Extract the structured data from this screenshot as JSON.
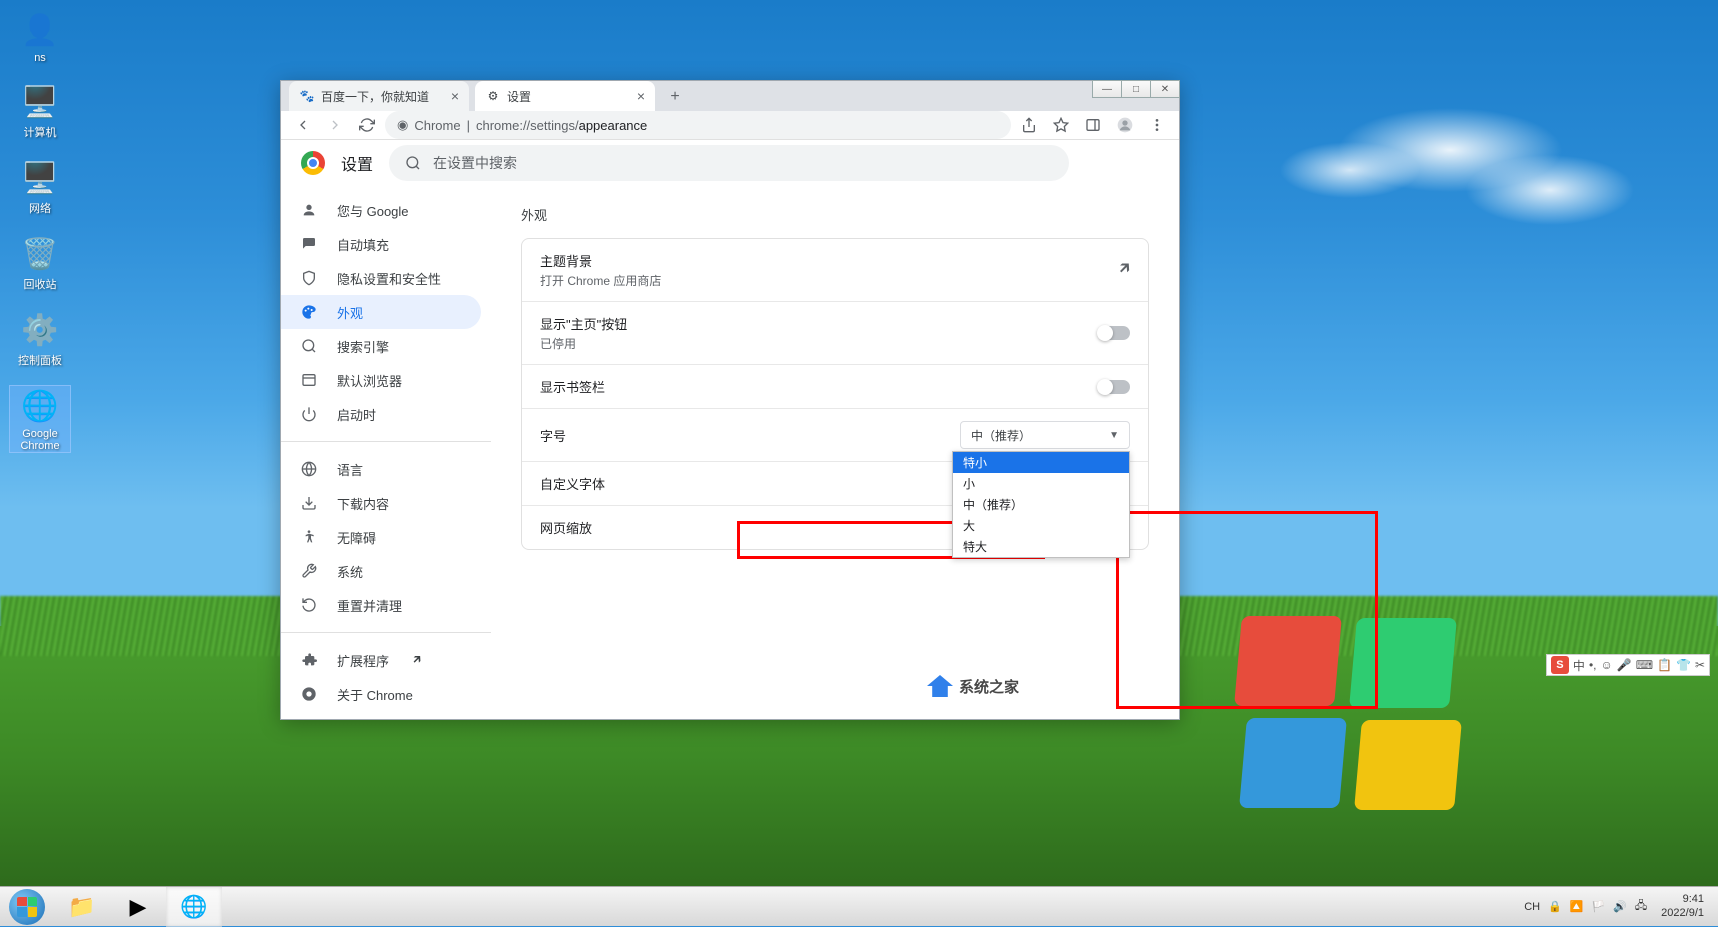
{
  "desktop_icons": [
    {
      "label": "ns",
      "glyph": "👤"
    },
    {
      "label": "计算机",
      "glyph": "🖥️"
    },
    {
      "label": "网络",
      "glyph": "🖥️"
    },
    {
      "label": "回收站",
      "glyph": "🗑️"
    },
    {
      "label": "控制面板",
      "glyph": "⚙️"
    },
    {
      "label": "Google Chrome",
      "glyph": "🌐"
    }
  ],
  "window_controls": {
    "min": "—",
    "max": "□",
    "close": "✕"
  },
  "tabs": [
    {
      "title": "百度一下，你就知道",
      "favicon": "🐾",
      "active": false
    },
    {
      "title": "设置",
      "favicon": "⚙",
      "active": true
    }
  ],
  "address_bar": {
    "chrome_label": "Chrome",
    "separator": " | ",
    "url_scheme": "chrome://",
    "url_host": "settings/",
    "url_path": "appearance"
  },
  "settings": {
    "title": "设置",
    "search_placeholder": "在设置中搜索",
    "sidebar": [
      {
        "icon": "person",
        "label": "您与 Google"
      },
      {
        "icon": "autofill",
        "label": "自动填充"
      },
      {
        "icon": "shield",
        "label": "隐私设置和安全性"
      },
      {
        "icon": "palette",
        "label": "外观",
        "active": true
      },
      {
        "icon": "search",
        "label": "搜索引擎"
      },
      {
        "icon": "browser",
        "label": "默认浏览器"
      },
      {
        "icon": "power",
        "label": "启动时"
      }
    ],
    "sidebar2": [
      {
        "icon": "globe",
        "label": "语言"
      },
      {
        "icon": "download",
        "label": "下载内容"
      },
      {
        "icon": "accessibility",
        "label": "无障碍"
      },
      {
        "icon": "wrench",
        "label": "系统"
      },
      {
        "icon": "reset",
        "label": "重置并清理"
      }
    ],
    "sidebar3": [
      {
        "icon": "extension",
        "label": "扩展程序",
        "external": true
      },
      {
        "icon": "chrome",
        "label": "关于 Chrome"
      }
    ],
    "section_label": "外观",
    "rows": {
      "theme": {
        "title": "主题背景",
        "sub": "打开 Chrome 应用商店"
      },
      "home_button": {
        "title": "显示\"主页\"按钮",
        "sub": "已停用"
      },
      "bookmarks_bar": {
        "title": "显示书签栏"
      },
      "font_size": {
        "title": "字号",
        "value": "中（推荐）"
      },
      "custom_fonts": {
        "title": "自定义字体"
      },
      "page_zoom": {
        "title": "网页缩放"
      }
    },
    "font_dropdown": [
      "特小",
      "小",
      "中（推荐）",
      "大",
      "特大"
    ],
    "font_dropdown_highlighted": 0
  },
  "watermark": {
    "text": "系统之家"
  },
  "ime": {
    "items": [
      "中",
      "•,",
      "☺",
      "🎤",
      "⌨",
      "📋",
      "👕",
      "✂"
    ]
  },
  "taskbar": {
    "items": [
      "📁",
      "▶",
      "🌐"
    ],
    "tray": {
      "lang": "CH",
      "icons": [
        "🔒",
        "🔼",
        "🏳️",
        "🔊",
        "🖧"
      ]
    },
    "clock": {
      "time": "9:41",
      "date": "2022/9/1"
    }
  }
}
